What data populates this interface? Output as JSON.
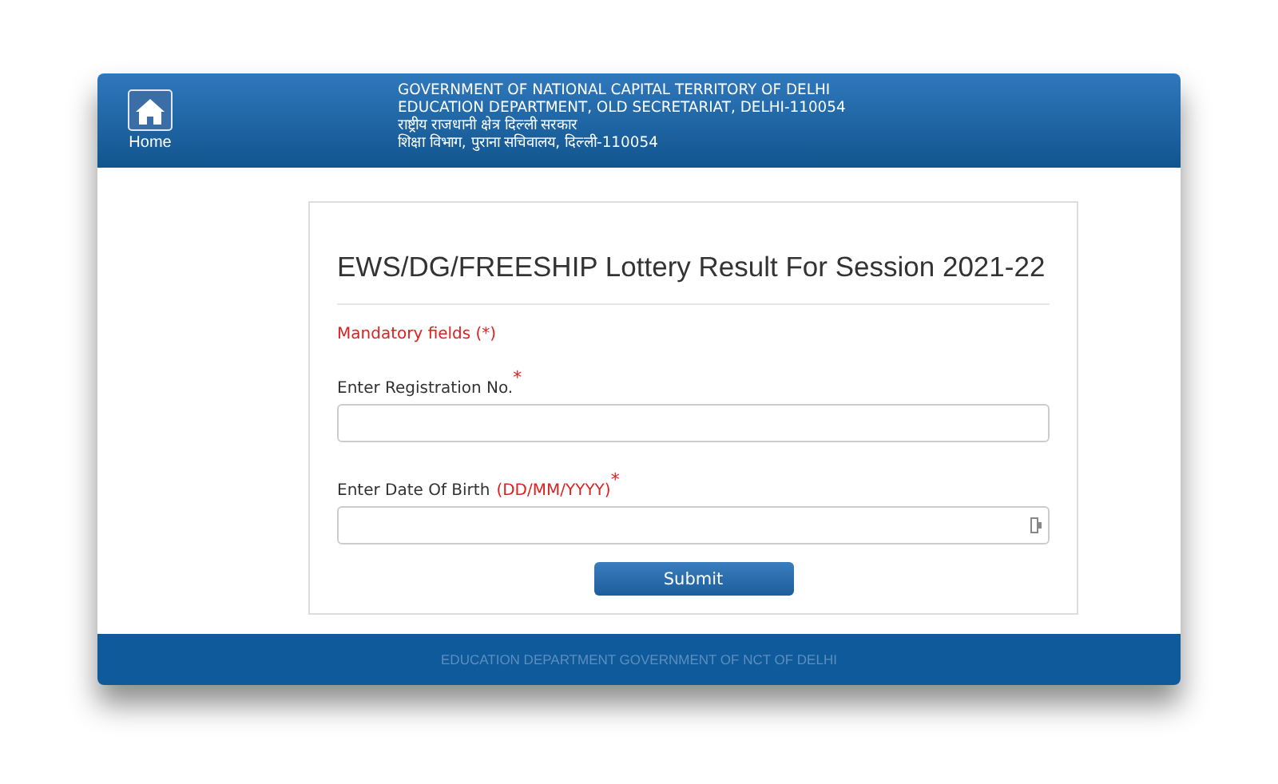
{
  "header": {
    "home_label": "Home",
    "lines": [
      "GOVERNMENT OF NATIONAL CAPITAL TERRITORY OF DELHI",
      "EDUCATION DEPARTMENT, OLD SECRETARIAT, DELHI-110054",
      "राष्ट्रीय राजधानी क्षेत्र दिल्ली सरकार",
      "शिक्षा विभाग, पुराना सचिवालय, दिल्ली-110054"
    ]
  },
  "form": {
    "title": "EWS/DG/FREESHIP Lottery Result For Session 2021-22",
    "mandatory_note": "Mandatory fields (*)",
    "fields": [
      {
        "label": "Enter Registration No.",
        "required_mark": "*",
        "kind": "text"
      },
      {
        "label": "Enter Date Of Birth",
        "hint": "(DD/MM/YYYY)",
        "required_mark": "*",
        "kind": "date"
      }
    ],
    "submit": "Submit"
  },
  "footer": "EDUCATION DEPARTMENT GOVERNMENT OF NCT OF DELHI"
}
